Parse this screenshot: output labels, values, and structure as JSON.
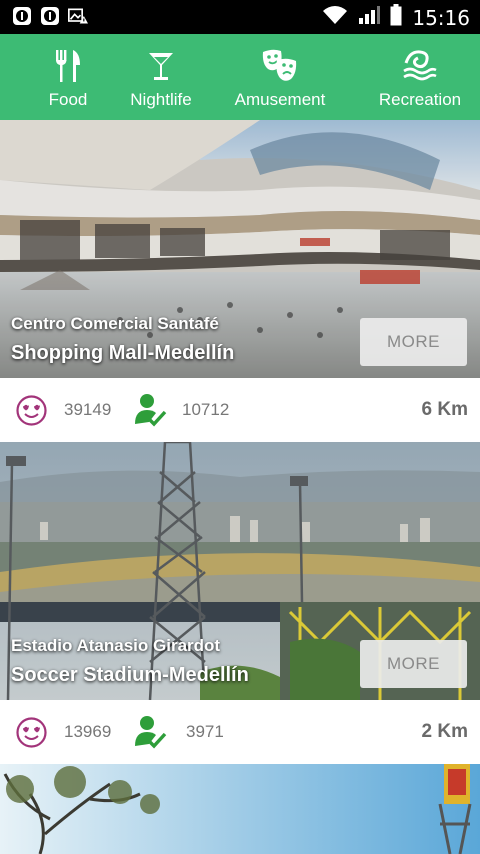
{
  "status_bar": {
    "time": "15:16"
  },
  "categories": [
    {
      "label": "Food",
      "icon": "fork-knife-icon"
    },
    {
      "label": "Nightlife",
      "icon": "cocktail-icon"
    },
    {
      "label": "Amusement",
      "icon": "theater-masks-icon"
    },
    {
      "label": "Recreation",
      "icon": "waves-icon"
    }
  ],
  "places": [
    {
      "name": "Centro Comercial Santafé",
      "subtitle": "Shopping Mall-Medellín",
      "more_label": "MORE",
      "likes": "39149",
      "visits": "10712",
      "distance": "6 Km"
    },
    {
      "name": "Estadio Atanasio Girardot",
      "subtitle": "Soccer Stadium-Medellín",
      "more_label": "MORE",
      "likes": "13969",
      "visits": "3971",
      "distance": "2 Km"
    }
  ],
  "colors": {
    "brand_green": "#3dbb74",
    "heart_purple": "#a2347a",
    "user_green": "#2e9e3a"
  }
}
